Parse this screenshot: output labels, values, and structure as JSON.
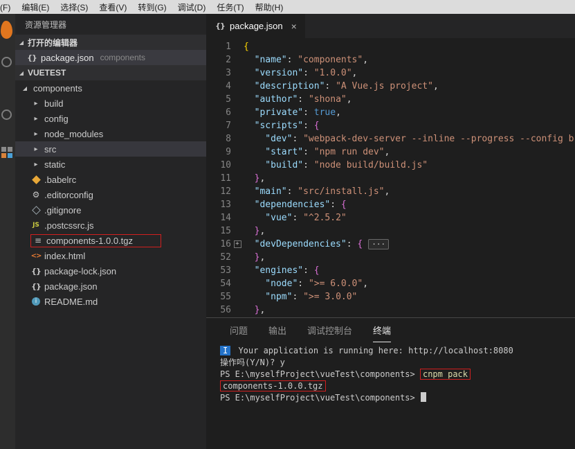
{
  "menubar": {
    "ids": [
      "file",
      "edit",
      "selection",
      "view",
      "goto",
      "debug",
      "tasks",
      "help"
    ],
    "items": [
      "文件(F)",
      "编辑(E)",
      "选择(S)",
      "查看(V)",
      "转到(G)",
      "调试(D)",
      "任务(T)",
      "帮助(H)"
    ]
  },
  "activity_bar": {
    "icons": [
      "explorer-icon",
      "search-icon",
      "debug-icon",
      "extensions-icon"
    ]
  },
  "sidebar": {
    "title": "资源管理器",
    "open_editors": {
      "label": "打开的编辑器",
      "file": {
        "name": "package.json",
        "detail": "components",
        "icon": "json-icon"
      }
    },
    "section_label": "VUETEST",
    "tree": [
      {
        "label": "components",
        "icon": "chevron-expanded",
        "indent": 0
      },
      {
        "label": "build",
        "icon": "chevron-collapsed",
        "indent": 1
      },
      {
        "label": "config",
        "icon": "chevron-collapsed",
        "indent": 1
      },
      {
        "label": "node_modules",
        "icon": "chevron-collapsed",
        "indent": 1
      },
      {
        "label": "src",
        "icon": "chevron-collapsed",
        "indent": 1,
        "selected": true
      },
      {
        "label": "static",
        "icon": "chevron-collapsed",
        "indent": 1
      },
      {
        "label": ".babelrc",
        "icon": "babel",
        "indent": 1
      },
      {
        "label": ".editorconfig",
        "icon": "gear",
        "indent": 1
      },
      {
        "label": ".gitignore",
        "icon": "git",
        "indent": 1
      },
      {
        "label": ".postcssrc.js",
        "icon": "js",
        "indent": 1
      },
      {
        "label": "components-1.0.0.tgz",
        "icon": "file",
        "indent": 1,
        "annotated": true
      },
      {
        "label": "index.html",
        "icon": "html",
        "indent": 1
      },
      {
        "label": "package-lock.json",
        "icon": "json",
        "indent": 1
      },
      {
        "label": "package.json",
        "icon": "json",
        "indent": 1
      },
      {
        "label": "README.md",
        "icon": "info",
        "indent": 1
      }
    ]
  },
  "editor": {
    "tab": {
      "title": "package.json",
      "close": "×",
      "icon": "json-icon"
    },
    "lines": [
      {
        "n": "1",
        "segs": [
          [
            "g",
            "{"
          ]
        ]
      },
      {
        "n": "2",
        "segs": [
          [
            "k",
            "  \"name\""
          ],
          [
            "p",
            ": "
          ],
          [
            "s",
            "\"components\""
          ],
          [
            "p",
            ","
          ]
        ]
      },
      {
        "n": "3",
        "segs": [
          [
            "k",
            "  \"version\""
          ],
          [
            "p",
            ": "
          ],
          [
            "s",
            "\"1.0.0\""
          ],
          [
            "p",
            ","
          ]
        ]
      },
      {
        "n": "4",
        "segs": [
          [
            "k",
            "  \"description\""
          ],
          [
            "p",
            ": "
          ],
          [
            "s",
            "\"A Vue.js project\""
          ],
          [
            "p",
            ","
          ]
        ]
      },
      {
        "n": "5",
        "segs": [
          [
            "k",
            "  \"author\""
          ],
          [
            "p",
            ": "
          ],
          [
            "s",
            "\"shona\""
          ],
          [
            "p",
            ","
          ]
        ]
      },
      {
        "n": "6",
        "segs": [
          [
            "k",
            "  \"private\""
          ],
          [
            "p",
            ": "
          ],
          [
            "b",
            "true"
          ],
          [
            "p",
            ","
          ]
        ]
      },
      {
        "n": "7",
        "segs": [
          [
            "k",
            "  \"scripts\""
          ],
          [
            "p",
            ": "
          ],
          [
            "m",
            "{"
          ]
        ]
      },
      {
        "n": "8",
        "segs": [
          [
            "k",
            "    \"dev\""
          ],
          [
            "p",
            ": "
          ],
          [
            "s",
            "\"webpack-dev-server --inline --progress --config b"
          ]
        ]
      },
      {
        "n": "9",
        "segs": [
          [
            "k",
            "    \"start\""
          ],
          [
            "p",
            ": "
          ],
          [
            "s",
            "\"npm run dev\""
          ],
          [
            "p",
            ","
          ]
        ]
      },
      {
        "n": "10",
        "segs": [
          [
            "k",
            "    \"build\""
          ],
          [
            "p",
            ": "
          ],
          [
            "s",
            "\"node build/build.js\""
          ]
        ]
      },
      {
        "n": "11",
        "segs": [
          [
            "m",
            "  }"
          ],
          [
            "p",
            ","
          ]
        ]
      },
      {
        "n": "12",
        "segs": [
          [
            "k",
            "  \"main\""
          ],
          [
            "p",
            ": "
          ],
          [
            "s",
            "\"src/install.js\""
          ],
          [
            "p",
            ","
          ]
        ]
      },
      {
        "n": "13",
        "segs": [
          [
            "k",
            "  \"dependencies\""
          ],
          [
            "p",
            ": "
          ],
          [
            "m",
            "{"
          ]
        ]
      },
      {
        "n": "14",
        "segs": [
          [
            "k",
            "    \"vue\""
          ],
          [
            "p",
            ": "
          ],
          [
            "s",
            "\"^2.5.2\""
          ]
        ]
      },
      {
        "n": "15",
        "segs": [
          [
            "m",
            "  }"
          ],
          [
            "p",
            ","
          ]
        ]
      },
      {
        "n": "16",
        "fold": "+",
        "segs": [
          [
            "k",
            "  \"devDependencies\""
          ],
          [
            "p",
            ": "
          ],
          [
            "m",
            "{"
          ],
          [
            "fb",
            "···",
            "folded-code-badge"
          ]
        ]
      },
      {
        "n": "52",
        "segs": [
          [
            "m",
            "  }"
          ],
          [
            "p",
            ","
          ]
        ]
      },
      {
        "n": "53",
        "segs": [
          [
            "k",
            "  \"engines\""
          ],
          [
            "p",
            ": "
          ],
          [
            "m",
            "{"
          ]
        ]
      },
      {
        "n": "54",
        "segs": [
          [
            "k",
            "    \"node\""
          ],
          [
            "p",
            ": "
          ],
          [
            "s",
            "\">= 6.0.0\""
          ],
          [
            "p",
            ","
          ]
        ]
      },
      {
        "n": "55",
        "segs": [
          [
            "k",
            "    \"npm\""
          ],
          [
            "p",
            ": "
          ],
          [
            "s",
            "\">= 3.0.0\""
          ]
        ]
      },
      {
        "n": "56",
        "segs": [
          [
            "m",
            "  }"
          ],
          [
            "p",
            ","
          ]
        ]
      }
    ]
  },
  "panel": {
    "tabs": [
      {
        "id": "problems",
        "label": "问题"
      },
      {
        "id": "output",
        "label": "输出"
      },
      {
        "id": "debug-console",
        "label": "调试控制台"
      },
      {
        "id": "terminal",
        "label": "终端",
        "active": true
      }
    ],
    "terminal": [
      {
        "segs": [
          [
            "badge",
            "I",
            "info-badge"
          ],
          [
            "t",
            " Your application is running here: http://localhost:8080"
          ]
        ]
      },
      {
        "segs": [
          [
            "t",
            "操作吗(Y/N)? y"
          ]
        ]
      },
      {
        "segs": [
          [
            "t",
            "PS E:\\myselfProject\\vueTest\\components> "
          ],
          [
            "cmd boxed",
            "cnpm pack",
            "command-text"
          ]
        ]
      },
      {
        "segs": [
          [
            "t boxed",
            "components-1.0.0.tgz",
            "package-filename"
          ]
        ]
      },
      {
        "segs": [
          [
            "t",
            "PS E:\\myselfProject\\vueTest\\components> "
          ],
          [
            "cursor",
            "",
            "terminal-cursor"
          ]
        ]
      }
    ]
  },
  "colors": {
    "annotation_red": "#d21f1f",
    "info_badge_blue": "#2472c8",
    "selection_background": "#37373d",
    "key_blue": "#9cdcfe",
    "string_orange": "#ce9178"
  }
}
